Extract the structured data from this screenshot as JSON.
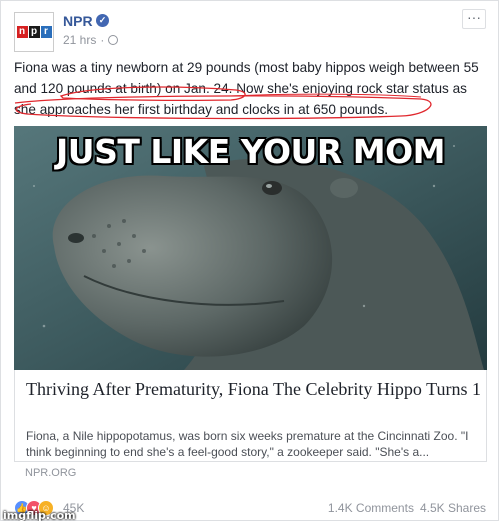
{
  "post": {
    "page_name": "NPR",
    "verified_icon": "verified-check-icon",
    "timestamp": "21 hrs",
    "separator": "·",
    "privacy_icon": "globe-icon",
    "more_label": "···",
    "caption": "Fiona was a tiny newborn at 29 pounds (most baby hippos weigh between 55 and 120 pounds at birth) on Jan. 24. Now she's enjoying rock star status as she approaches her first birthday and clocks in at 650 pounds.",
    "avatar_letters": [
      "n",
      "p",
      "r"
    ]
  },
  "image": {
    "meme_text": "JUST LIKE YOUR MOM",
    "subject": "hippo-photo"
  },
  "link": {
    "title": "Thriving After Prematurity, Fiona The Celebrity Hippo Turns 1",
    "description": "Fiona, a Nile hippopotamus, was born six weeks premature at the Cincinnati Zoo. \"I think beginning to end she's a feel-good story,\" a zookeeper said. \"She's a...",
    "source": "NPR.ORG"
  },
  "footer": {
    "reaction_count": "45K",
    "comments": "1.4K Comments",
    "shares": "4.5K Shares",
    "reaction_icons": [
      "like-icon",
      "love-icon",
      "haha-icon"
    ]
  },
  "watermark": "imgflip.com",
  "colors": {
    "accent": "#365899",
    "annotation": "#e0282e",
    "npr_red": "#d62021",
    "npr_black": "#1a1a1a",
    "npr_blue": "#2a6ebb"
  }
}
